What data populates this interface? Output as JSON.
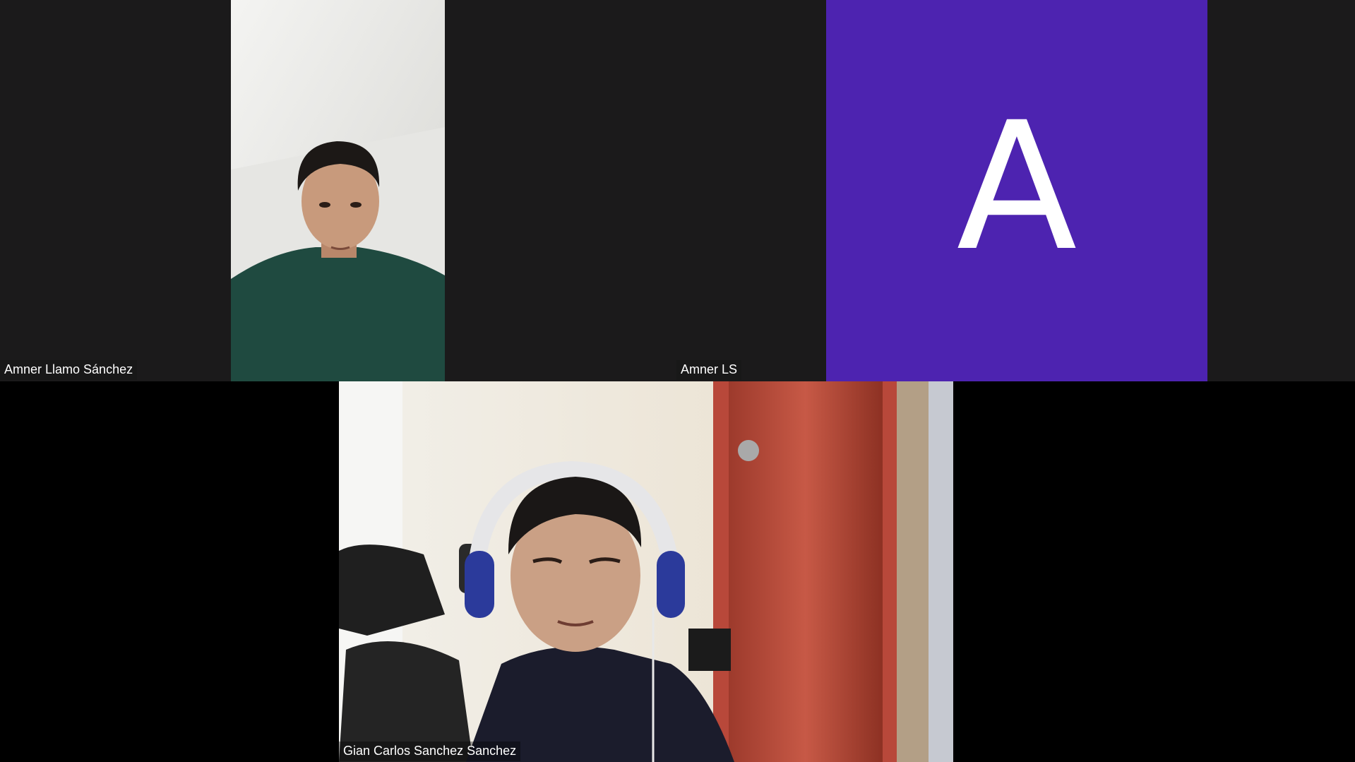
{
  "participants": [
    {
      "name": "Amner Llamo Sánchez",
      "video": "camera-on"
    },
    {
      "name": "Amner LS",
      "video": "camera-off",
      "avatar_letter": "A",
      "avatar_color": "#4d23b0"
    },
    {
      "name": "Gian Carlos Sanchez Sanchez",
      "video": "camera-on"
    }
  ],
  "colors": {
    "tile_background": "#1b1a1b",
    "bottom_background": "#000000",
    "label_text": "#ffffff"
  }
}
